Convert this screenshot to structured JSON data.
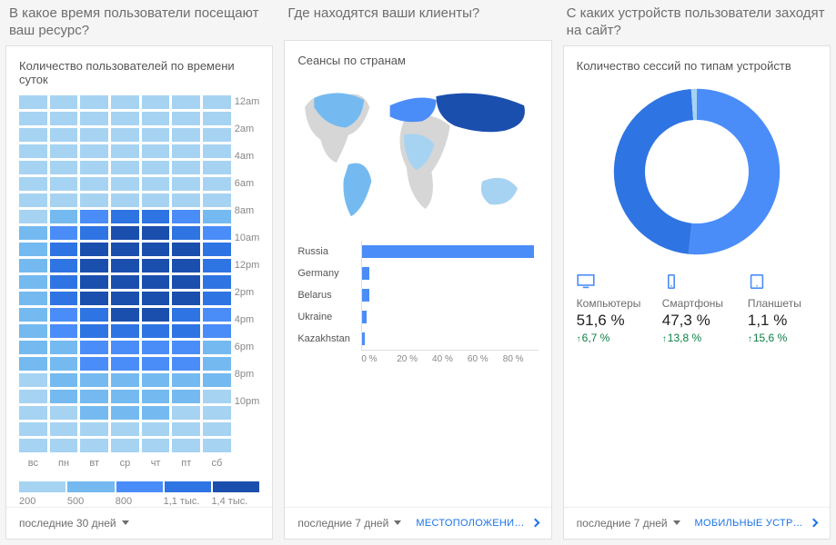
{
  "panels": {
    "heatmap": {
      "question": "В какое время пользователи посещают ваш ресурс?",
      "title": "Количество пользователей по времени суток",
      "footer_range": "последние 30 дней"
    },
    "map": {
      "question": "Где находятся ваши клиенты?",
      "title": "Сеансы по странам",
      "footer_range": "последние 7 дней",
      "footer_link": "МЕСТОПОЛОЖЕНИ…"
    },
    "devices": {
      "question": "С каких устройств пользователи заходят на сайт?",
      "title": "Количество сессий по типам устройств",
      "footer_range": "последние 7 дней",
      "footer_link": "МОБИЛЬНЫЕ УСТР…",
      "stats": {
        "desktop": {
          "label": "Компьютеры",
          "value": "51,6 %",
          "delta": "6,7 %"
        },
        "mobile": {
          "label": "Смартфоны",
          "value": "47,3 %",
          "delta": "13,8 %"
        },
        "tablet": {
          "label": "Планшеты",
          "value": "1,1 %",
          "delta": "15,6 %"
        }
      }
    }
  },
  "chart_data": [
    {
      "type": "heatmap",
      "title": "Количество пользователей по времени суток",
      "x_categories": [
        "вс",
        "пн",
        "вт",
        "ср",
        "чт",
        "пт",
        "сб"
      ],
      "y_categories": [
        "12am",
        "2am",
        "4am",
        "6am",
        "8am",
        "10am",
        "12pm",
        "2pm",
        "4pm",
        "6pm",
        "8pm",
        "10pm"
      ],
      "legend_stops": [
        "200",
        "500",
        "800",
        "1,1 тыс.",
        "1,4 тыс."
      ],
      "colors": [
        "#a6d3f2",
        "#74baf0",
        "#4b8df8",
        "#2f74e3",
        "#1b4fae"
      ],
      "values": [
        [
          0,
          0,
          0,
          0,
          0,
          0,
          0
        ],
        [
          0,
          0,
          0,
          0,
          0,
          0,
          0
        ],
        [
          0,
          0,
          0,
          0,
          0,
          0,
          0
        ],
        [
          0,
          0,
          0,
          0,
          0,
          0,
          0
        ],
        [
          0,
          0,
          0,
          0,
          0,
          0,
          0
        ],
        [
          0,
          0,
          0,
          0,
          0,
          0,
          0
        ],
        [
          0,
          0,
          0,
          0,
          0,
          0,
          0
        ],
        [
          0,
          1,
          2,
          3,
          3,
          2,
          1
        ],
        [
          1,
          2,
          3,
          4,
          4,
          3,
          2
        ],
        [
          1,
          3,
          4,
          4,
          4,
          4,
          3
        ],
        [
          1,
          3,
          4,
          4,
          4,
          4,
          3
        ],
        [
          1,
          3,
          4,
          4,
          4,
          4,
          3
        ],
        [
          1,
          3,
          4,
          4,
          4,
          4,
          3
        ],
        [
          1,
          2,
          3,
          4,
          4,
          3,
          2
        ],
        [
          1,
          2,
          3,
          3,
          3,
          3,
          2
        ],
        [
          1,
          1,
          2,
          2,
          2,
          2,
          1
        ],
        [
          1,
          1,
          2,
          2,
          2,
          2,
          1
        ],
        [
          0,
          1,
          1,
          1,
          1,
          1,
          1
        ],
        [
          0,
          1,
          1,
          1,
          1,
          1,
          0
        ],
        [
          0,
          0,
          1,
          1,
          1,
          0,
          0
        ],
        [
          0,
          0,
          0,
          0,
          0,
          0,
          0
        ],
        [
          0,
          0,
          0,
          0,
          0,
          0,
          0
        ]
      ]
    },
    {
      "type": "bar",
      "title": "Сеансы по странам",
      "orientation": "horizontal",
      "xlabel": "%",
      "xlim": [
        0,
        80
      ],
      "ticks": [
        "0 %",
        "20 %",
        "40 %",
        "60 %",
        "80 %"
      ],
      "categories": [
        "Russia",
        "Germany",
        "Belarus",
        "Ukraine",
        "Kazakhstan"
      ],
      "values": [
        78,
        3,
        3,
        2,
        1
      ]
    },
    {
      "type": "pie",
      "subtype": "donut",
      "title": "Количество сессий по типам устройств",
      "categories": [
        "Компьютеры",
        "Смартфоны",
        "Планшеты"
      ],
      "values": [
        51.6,
        47.3,
        1.1
      ],
      "colors": [
        "#4b8df8",
        "#2f74e3",
        "#a6d3f2"
      ],
      "deltas": [
        6.7,
        13.8,
        15.6
      ]
    }
  ]
}
